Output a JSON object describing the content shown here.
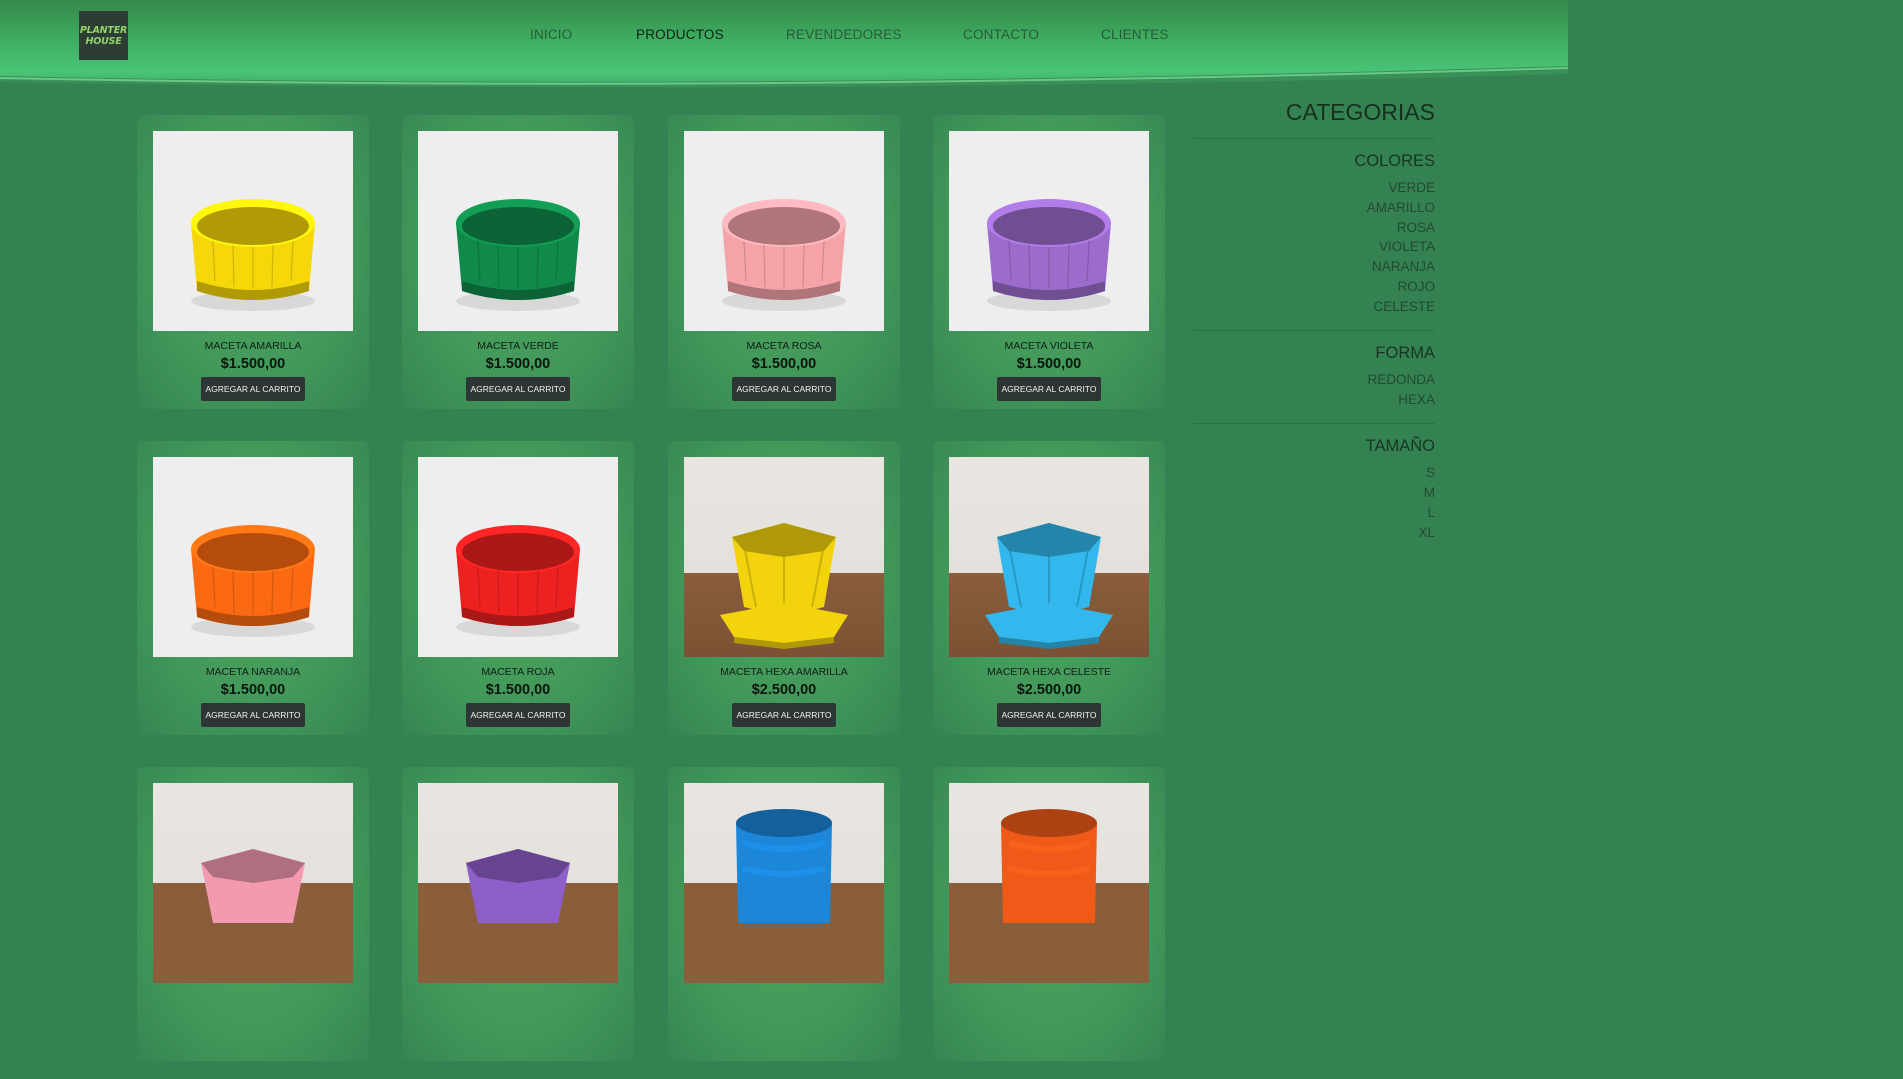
{
  "header": {
    "logo_line1": "PLANTER",
    "logo_line2": "HOUSE",
    "nav": [
      "INICIO",
      "PRODUCTOS",
      "REVENDEDORES",
      "CONTACTO",
      "CLIENTES"
    ],
    "active_nav": "PRODUCTOS"
  },
  "products": [
    {
      "name": "MACETA AMARILLA",
      "price": "$1.500,00",
      "button": "AGREGAR AL CARRITO",
      "color": "#f5d70a",
      "shape": "round"
    },
    {
      "name": "MACETA VERDE",
      "price": "$1.500,00",
      "button": "AGREGAR AL CARRITO",
      "color": "#10894a",
      "shape": "round"
    },
    {
      "name": "MACETA ROSA",
      "price": "$1.500,00",
      "button": "AGREGAR AL CARRITO",
      "color": "#f5a3a8",
      "shape": "round"
    },
    {
      "name": "MACETA VIOLETA",
      "price": "$1.500,00",
      "button": "AGREGAR AL CARRITO",
      "color": "#9b6ccb",
      "shape": "round"
    },
    {
      "name": "MACETA NARANJA",
      "price": "$1.500,00",
      "button": "AGREGAR AL CARRITO",
      "color": "#fb6a12",
      "shape": "round"
    },
    {
      "name": "MACETA ROJA",
      "price": "$1.500,00",
      "button": "AGREGAR AL CARRITO",
      "color": "#ec2120",
      "shape": "round"
    },
    {
      "name": "MACETA HEXA AMARILLA",
      "price": "$2.500,00",
      "button": "AGREGAR AL CARRITO",
      "color": "#f3d40c",
      "shape": "hexa"
    },
    {
      "name": "MACETA HEXA CELESTE",
      "price": "$2.500,00",
      "button": "AGREGAR AL CARRITO",
      "color": "#32b8ec",
      "shape": "hexa"
    },
    {
      "color": "#f39ab0",
      "shape": "hexa-partial"
    },
    {
      "color": "#8e5fc8",
      "shape": "hexa-partial"
    },
    {
      "color": "#1c86d9",
      "shape": "tall-partial"
    },
    {
      "color": "#ef5a18",
      "shape": "tall-partial"
    }
  ],
  "sidebar": {
    "title": "CATEGORIAS",
    "colores": {
      "title": "COLORES",
      "items": [
        "VERDE",
        "AMARILLO",
        "ROSA",
        "VIOLETA",
        "NARANJA",
        "ROJO",
        "CELESTE"
      ]
    },
    "forma": {
      "title": "FORMA",
      "items": [
        "REDONDA",
        "HEXA"
      ]
    },
    "tamano": {
      "title": "TAMAÑO",
      "items": [
        "S",
        "M",
        "L",
        "XL"
      ]
    }
  }
}
